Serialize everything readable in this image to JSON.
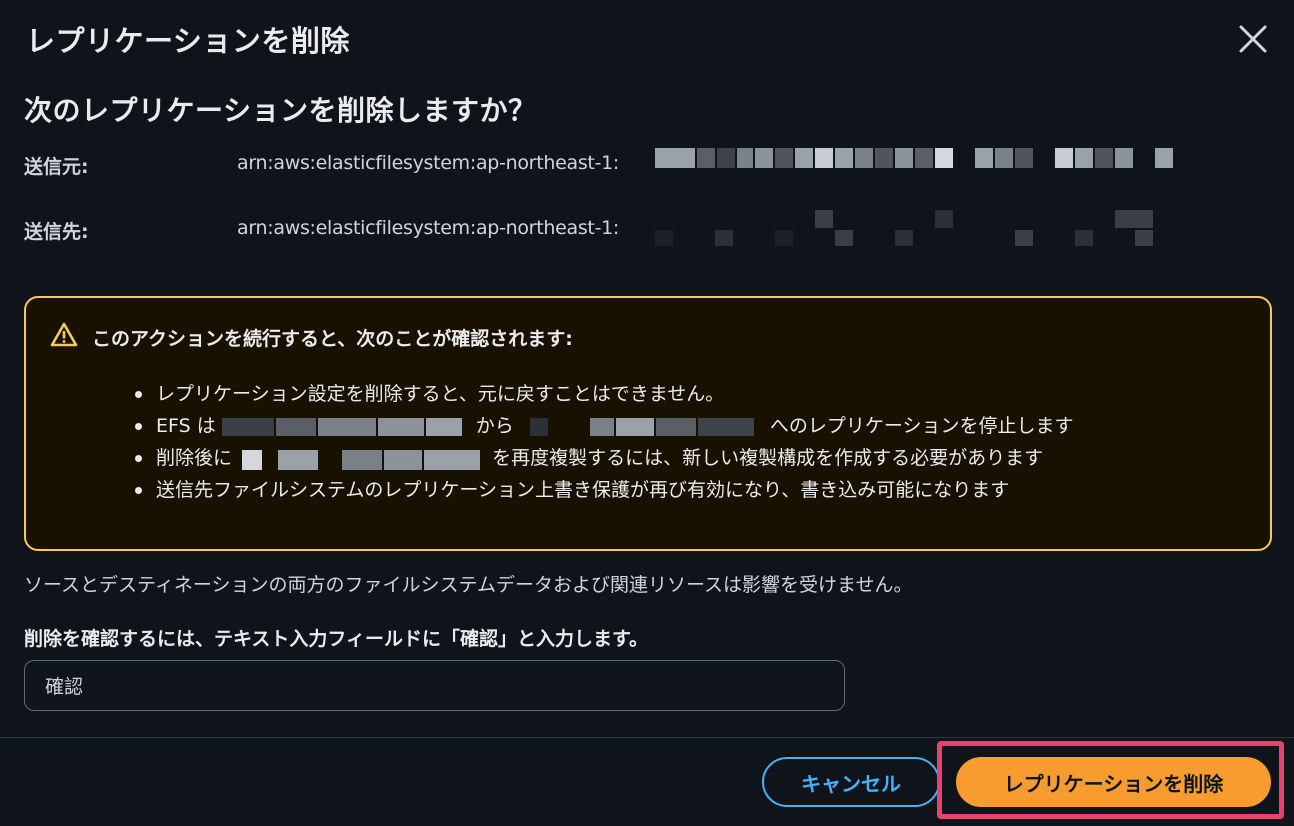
{
  "dialog": {
    "title": "レプリケーションを削除",
    "question": "次のレプリケーションを削除しますか？",
    "close_icon": "close-icon"
  },
  "source": {
    "label": "送信元:",
    "value": "arn:aws:elasticfilesystem:ap-northeast-1:"
  },
  "destination": {
    "label": "送信先:",
    "value": "arn:aws:elasticfilesystem:ap-northeast-1:"
  },
  "alert": {
    "icon": "warning-icon",
    "heading": "このアクションを続行すると、次のことが確認されます:",
    "bullets": {
      "b1": "レプリケーション設定を削除すると、元に戻すことはできません。",
      "b2_pre": "EFS は",
      "b2_mid": "から",
      "b2_post": "へのレプリケーションを停止します",
      "b3_pre": "削除後に",
      "b3_post": "を再度複製するには、新しい複製構成を作成する必要があります",
      "b4": "送信先ファイルシステムのレプリケーション上書き保護が再び有効になり、書き込み可能になります"
    },
    "border_color": "#f2cd54"
  },
  "note": "ソースとデスティネーションの両方のファイルシステムデータおよび関連リソースは影響を受けません。",
  "confirm": {
    "label": "削除を確認するには、テキスト入力フィールドに「確認」と入力します。",
    "value": "確認"
  },
  "footer": {
    "cancel_label": "キャンセル",
    "delete_label": "レプリケーションを削除",
    "delete_color": "#f89c2f",
    "cancel_color": "#42b4ff",
    "highlight_color": "#e8406f"
  }
}
